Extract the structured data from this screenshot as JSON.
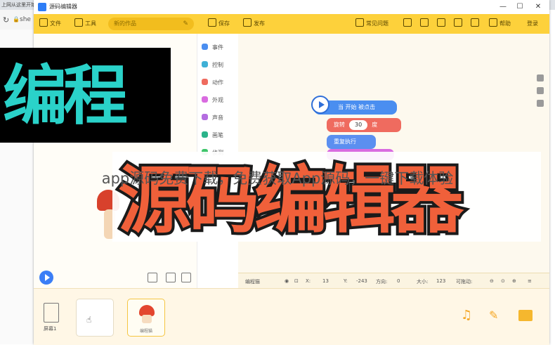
{
  "browser": {
    "tab_title": "上网从这里开始",
    "address_fragment": "she",
    "reload_glyph": "↻",
    "lock_glyph": "🔒"
  },
  "window": {
    "title": "源码编辑器",
    "controls": {
      "minimize": "—",
      "maximize": "☐",
      "close": "✕"
    }
  },
  "toolbar": {
    "file": "文件",
    "tools": "工具",
    "project_name_placeholder": "新的作品",
    "edit_glyph": "✎",
    "save": "保存",
    "publish": "发布",
    "faq": "常见问题",
    "help": "帮助",
    "login": "登录"
  },
  "categories": [
    {
      "label": "事件",
      "color": "#4a8ef0"
    },
    {
      "label": "控制",
      "color": "#3fb0d6"
    },
    {
      "label": "动作",
      "color": "#ef6b5f"
    },
    {
      "label": "外观",
      "color": "#d96be0"
    },
    {
      "label": "声音",
      "color": "#b46de0"
    },
    {
      "label": "画笔",
      "color": "#2bb38a"
    },
    {
      "label": "侦测",
      "color": "#3ec56a"
    }
  ],
  "blocks": {
    "hat": "当 开始 被点击",
    "rotate_prefix": "旋转",
    "rotate_value": "30",
    "rotate_unit": "度",
    "repeat": "重复执行"
  },
  "status": {
    "sprite": "编程猫",
    "x_label": "X:",
    "x_value": "13",
    "y_label": "Y:",
    "y_value": "-243",
    "dir_label": "方向:",
    "dir_value": "0",
    "size_label": "大小:",
    "size_value": "123",
    "drag_label": "可拖动:"
  },
  "sprites": {
    "stage_label": "屏幕1",
    "sprite_name": "编程猫",
    "cursor_glyph": "☝"
  },
  "tools": {
    "music_glyph": "♫",
    "pen_glyph": "✎"
  },
  "undo_glyph": "↶",
  "redo_glyph": "↷",
  "overlay": {
    "title_top": "编程",
    "title_bottom": "源码编辑器",
    "caption": "app源码免费下载，免费获取App源码，一键下载体验"
  }
}
